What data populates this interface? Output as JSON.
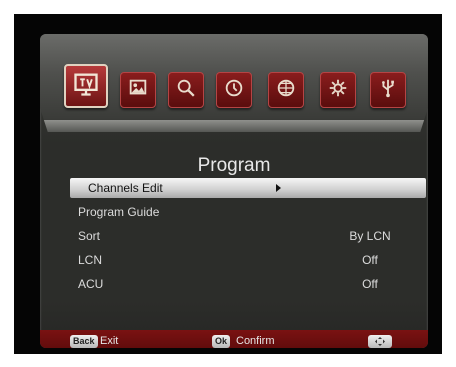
{
  "menu": {
    "title": "Program",
    "icons": [
      "tv-icon",
      "picture-icon",
      "search-icon",
      "clock-icon",
      "globe-icon",
      "gear-icon",
      "usb-icon"
    ],
    "active_icon": "tv-icon",
    "rows": [
      {
        "label": "Channels Edit",
        "value": ""
      },
      {
        "label": "Program Guide",
        "value": ""
      },
      {
        "label": "Sort",
        "value": "By LCN"
      },
      {
        "label": "LCN",
        "value": "Off"
      },
      {
        "label": "ACU",
        "value": "Off"
      }
    ],
    "selected_row": "Channels Edit"
  },
  "footer": {
    "back_key": "Back",
    "back_label": "Exit",
    "ok_key": "Ok",
    "ok_label": "Confirm",
    "nav_icon": "dpad-icon"
  },
  "colors": {
    "accent_red": "#7a1212",
    "tile_red": "#8a1d1d",
    "panel_dark": "#2c2d2a",
    "highlight": "#e6e6e6"
  }
}
